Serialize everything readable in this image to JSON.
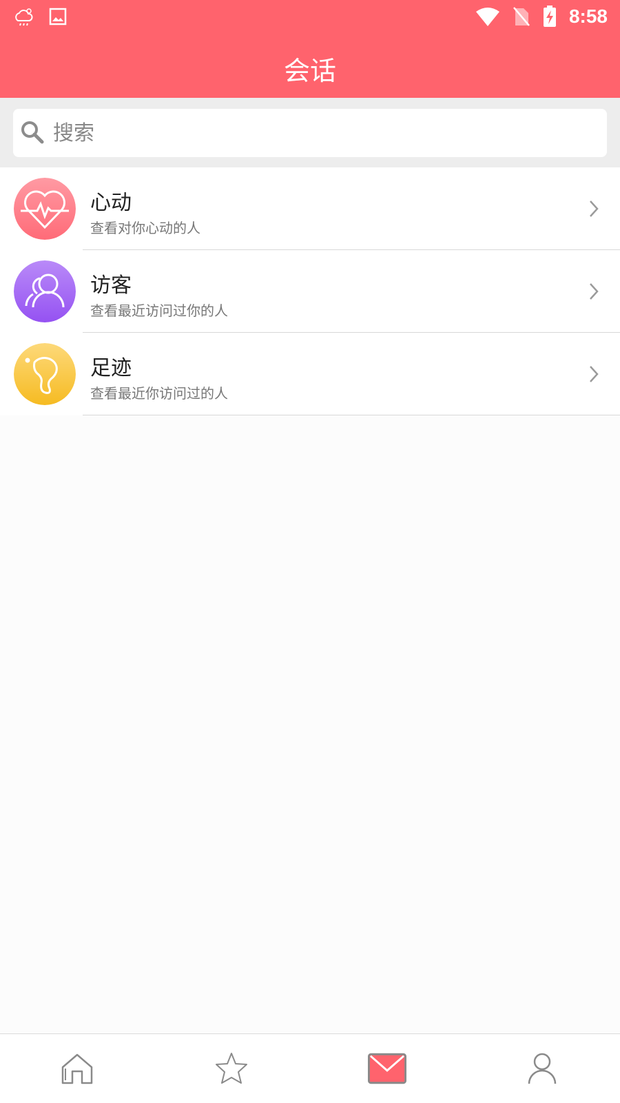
{
  "status_bar": {
    "time": "8:58",
    "left_icons": [
      "weather-icon",
      "image-icon"
    ],
    "right_icons": [
      "wifi-icon",
      "no-sim-icon",
      "battery-charging-icon"
    ]
  },
  "header": {
    "title": "会话"
  },
  "search": {
    "placeholder": "搜索",
    "value": ""
  },
  "list": {
    "items": [
      {
        "title": "心动",
        "subtitle": "查看对你心动的人",
        "icon": "heart-pulse-icon",
        "color": "#ff7a86"
      },
      {
        "title": "访客",
        "subtitle": "查看最近访问过你的人",
        "icon": "visitors-icon",
        "color": "#a66cf5"
      },
      {
        "title": "足迹",
        "subtitle": "查看最近你访问过的人",
        "icon": "footprint-icon",
        "color": "#f8c236"
      }
    ]
  },
  "tabbar": {
    "tabs": [
      {
        "name": "home",
        "icon": "home-icon"
      },
      {
        "name": "favorites",
        "icon": "star-icon"
      },
      {
        "name": "messages",
        "icon": "mail-icon",
        "active": true
      },
      {
        "name": "profile",
        "icon": "person-icon"
      }
    ],
    "active_color": "#ff636d",
    "inactive_color": "#8a8a8a"
  },
  "colors": {
    "brand": "#ff636d",
    "background": "#fcfcfc"
  }
}
